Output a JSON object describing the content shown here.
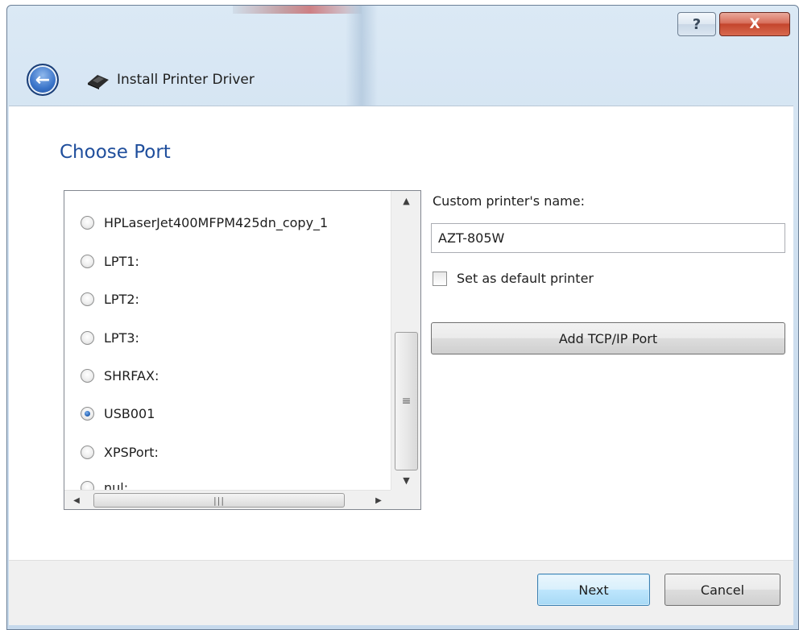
{
  "window": {
    "title": "Install Printer Driver",
    "help_glyph": "?",
    "close_glyph": "X",
    "back_icon": "back-arrow-icon",
    "title_icon": "printer-icon"
  },
  "page": {
    "heading": "Choose Port"
  },
  "ports": {
    "items": [
      {
        "label": "HPLaserJet400MFPM425dn_copy_1",
        "selected": false
      },
      {
        "label": "LPT1:",
        "selected": false
      },
      {
        "label": "LPT2:",
        "selected": false
      },
      {
        "label": "LPT3:",
        "selected": false
      },
      {
        "label": "SHRFAX:",
        "selected": false
      },
      {
        "label": "USB001",
        "selected": true
      },
      {
        "label": "XPSPort:",
        "selected": false
      },
      {
        "label": "nul:",
        "selected": false
      }
    ],
    "selected_value": "USB001"
  },
  "form": {
    "name_label": "Custom printer's name:",
    "name_value": "AZT-805W",
    "default_label": "Set as default printer",
    "default_checked": false,
    "tcp_button": "Add TCP/IP Port"
  },
  "footer": {
    "next": "Next",
    "cancel": "Cancel"
  },
  "colors": {
    "heading": "#1f4e9c",
    "next_border": "#3c7fb1",
    "close_button": "#c4452d"
  }
}
